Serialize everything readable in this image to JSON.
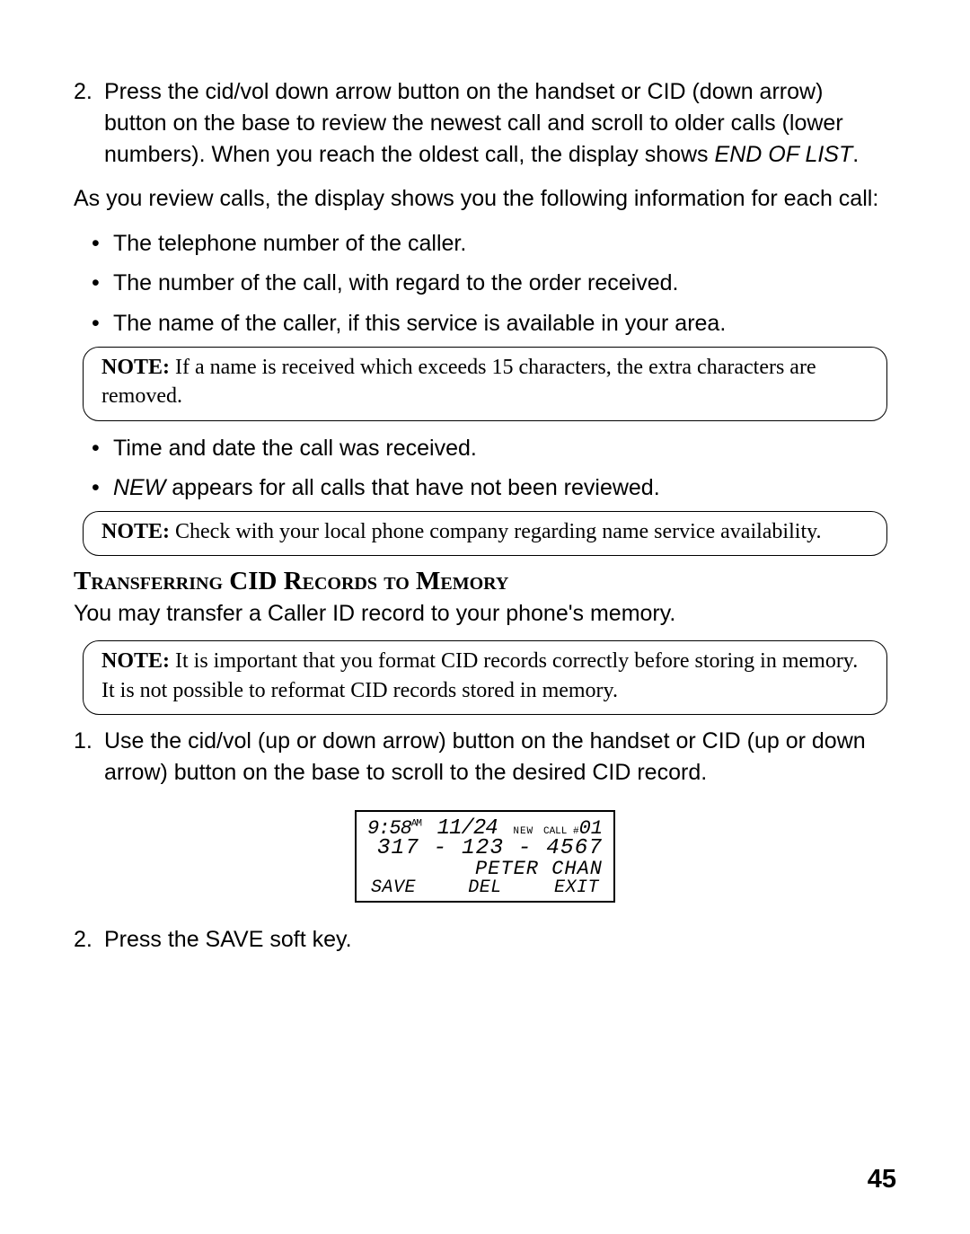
{
  "step2_num": "2.",
  "step2_body_a": "Press the cid/vol down arrow button on the handset or CID (down arrow) button on the base to review the newest call and scroll to older calls (lower numbers). When you reach the oldest call, the display shows ",
  "step2_body_b": "END OF LIST",
  "step2_body_c": ".",
  "review_para": "As you review calls, the display shows you the following information for each call:",
  "bullets": {
    "b1": "The telephone number of the caller.",
    "b2": "The number of the call, with regard to the order received.",
    "b3": "The name of the caller, if this service is available in your area.",
    "b4": "Time and date the call was received.",
    "b5_a": "NEW",
    "b5_b": " appears for all calls that have not been reviewed."
  },
  "note_label": "NOTE:",
  "note1": " If a name is received which exceeds 15 characters, the extra characters are removed.",
  "note2": " Check with your local phone company regarding name service availability.",
  "heading": "Transferring CID Records to Memory",
  "heading_sub": "You may transfer a Caller ID record to your phone's memory.",
  "note3": " It is important that you format CID records correctly before storing in memory. It is not possible to reformat CID records stored in memory.",
  "t_step1_num": "1.",
  "t_step1_body": "Use the cid/vol (up or down arrow) button on the handset or CID (up or down arrow) button on the base to scroll to the desired CID record.",
  "t_step2_num": "2.",
  "t_step2_body": "Press the SAVE soft key.",
  "lcd": {
    "time": "9:58",
    "ampm": "AM",
    "date": "11/24",
    "new": "NEW",
    "call_lbl": "CALL #",
    "call_no": "01",
    "phone": "317 - 123 - 4567",
    "name": "PETER CHAN",
    "sk1": "SAVE",
    "sk2": "DEL",
    "sk3": "EXIT"
  },
  "page": "45"
}
